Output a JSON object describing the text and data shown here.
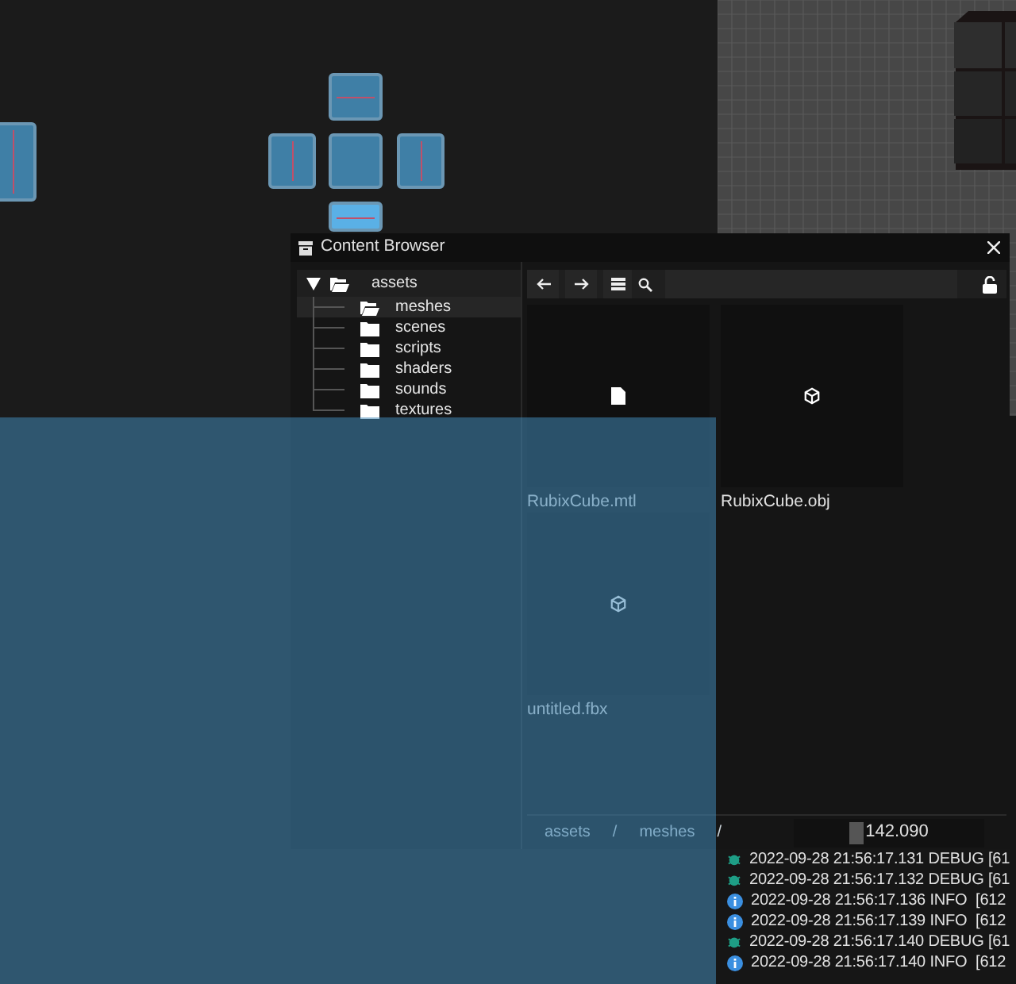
{
  "content_browser": {
    "title": "Content Browser",
    "tree": [
      {
        "label": "assets",
        "expanded": true,
        "selected": false,
        "children": [
          {
            "label": "meshes",
            "selected": true
          },
          {
            "label": "scenes",
            "selected": false
          },
          {
            "label": "scripts",
            "selected": false
          },
          {
            "label": "shaders",
            "selected": false
          },
          {
            "label": "sounds",
            "selected": false
          },
          {
            "label": "textures",
            "selected": false
          }
        ]
      }
    ],
    "files": [
      {
        "name": "RubixCube.mtl",
        "kind": "file"
      },
      {
        "name": "RubixCube.obj",
        "kind": "mesh"
      },
      {
        "name": "untitled.fbx",
        "kind": "mesh"
      }
    ],
    "breadcrumbs": [
      "assets",
      "/",
      "meshes",
      "/"
    ],
    "value_field": {
      "value": "142.090"
    }
  },
  "log": [
    {
      "kind": "debug",
      "text": "2022-09-28 21:56:17.131 DEBUG [61"
    },
    {
      "kind": "debug",
      "text": "2022-09-28 21:56:17.132 DEBUG [61"
    },
    {
      "kind": "info",
      "text": "2022-09-28 21:56:17.136 INFO  [612"
    },
    {
      "kind": "info",
      "text": "2022-09-28 21:56:17.139 INFO  [612"
    },
    {
      "kind": "debug",
      "text": "2022-09-28 21:56:17.140 DEBUG [61"
    },
    {
      "kind": "info",
      "text": "2022-09-28 21:56:17.140 INFO  [612"
    }
  ]
}
